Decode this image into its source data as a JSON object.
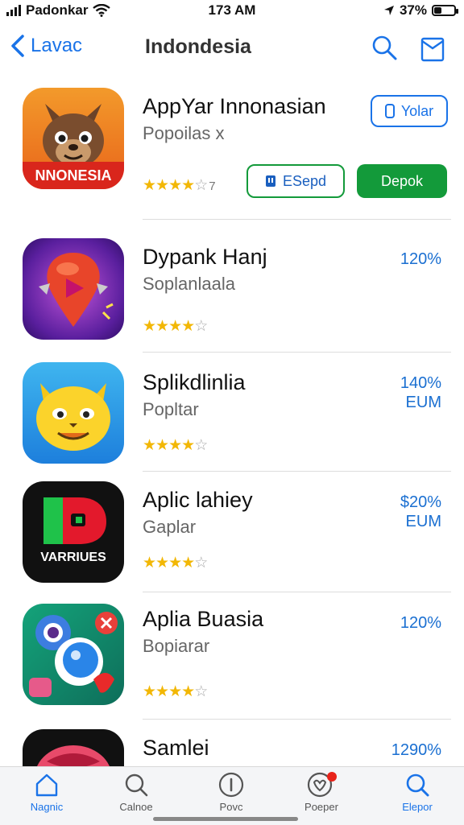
{
  "status": {
    "carrier": "Padonkar",
    "time": "173 AM",
    "battery": "37%",
    "battery_level": 0.37
  },
  "nav": {
    "back_label": "Lavac",
    "title": "Indondesia"
  },
  "featured": {
    "name": "AppYar Innonasian",
    "subtitle": "Popoilas x",
    "rating": 4,
    "rating_count": "7",
    "icon_text": "NNONESIA",
    "button_outline": "Yolar",
    "button_secondary": "ESepd",
    "button_primary": "Depok"
  },
  "apps": [
    {
      "name": "Dypank Hanj",
      "subtitle": "Soplanlaala",
      "rating": 3.5,
      "price_line1": "120%",
      "price_line2": ""
    },
    {
      "name": "Splikdlinlia",
      "subtitle": "Popltar",
      "rating": 3.5,
      "price_line1": "140%",
      "price_line2": "EUM"
    },
    {
      "name": "Aplic lahiey",
      "subtitle": "Gaplar",
      "rating": 3.5,
      "price_line1": "$20%",
      "price_line2": "EUM",
      "icon_text": "VARRIUES"
    },
    {
      "name": "Aplia Buasia",
      "subtitle": "Bopiarar",
      "rating": 3.5,
      "price_line1": "120%",
      "price_line2": ""
    },
    {
      "name": "Samlei",
      "subtitle": "",
      "rating": 3.5,
      "price_line1": "1290%",
      "price_line2": ""
    }
  ],
  "tabs": [
    {
      "label": "Nagnic",
      "icon": "house-icon",
      "active": true
    },
    {
      "label": "Calnoe",
      "icon": "search-icon",
      "active": false
    },
    {
      "label": "Povc",
      "icon": "info-circle-icon",
      "active": false
    },
    {
      "label": "Poeper",
      "icon": "heart-badge-icon",
      "active": false
    },
    {
      "label": "Elepor",
      "icon": "search-icon",
      "active": true
    }
  ],
  "colors": {
    "accent": "#1a73e8",
    "primary_button": "#139a3a",
    "star": "#f2b705"
  }
}
